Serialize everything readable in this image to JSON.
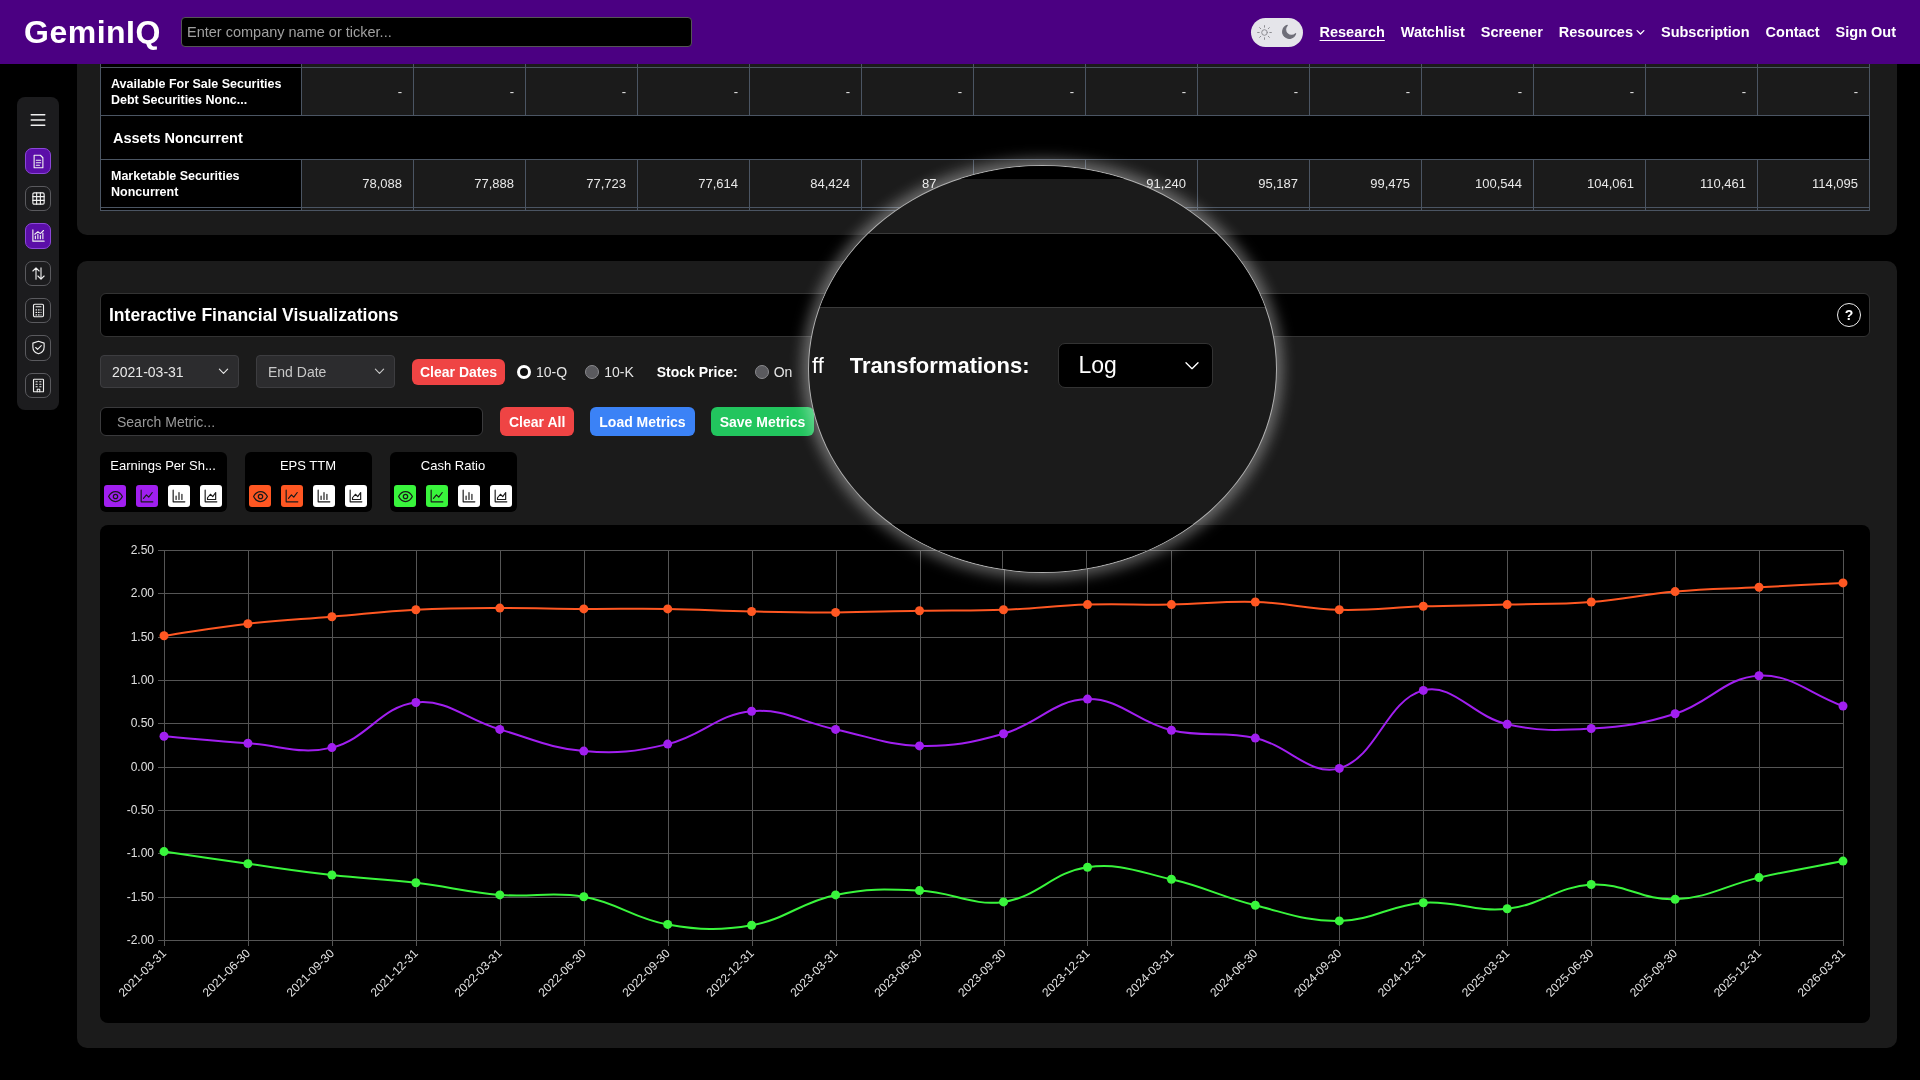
{
  "header": {
    "logo": "GeminIQ",
    "search": {
      "placeholder": "Enter company name or ticker..."
    },
    "theme_toggle": {
      "dark": true
    },
    "nav": [
      {
        "label": "Research",
        "selected": true,
        "dropdown": false
      },
      {
        "label": "Watchlist",
        "selected": false,
        "dropdown": false
      },
      {
        "label": "Screener",
        "selected": false,
        "dropdown": false
      },
      {
        "label": "Resources",
        "selected": false,
        "dropdown": true
      },
      {
        "label": "Subscription",
        "selected": false,
        "dropdown": false
      },
      {
        "label": "Contact",
        "selected": false,
        "dropdown": false
      },
      {
        "label": "Sign Out",
        "selected": false,
        "dropdown": false
      }
    ]
  },
  "sidebar": {
    "items": [
      {
        "kind": "menu",
        "selected": false
      },
      {
        "kind": "document",
        "selected": true
      },
      {
        "kind": "table",
        "selected": false
      },
      {
        "kind": "chart",
        "selected": true
      },
      {
        "kind": "transfer",
        "selected": false
      },
      {
        "kind": "calculator",
        "selected": false
      },
      {
        "kind": "shield",
        "selected": false
      },
      {
        "kind": "building",
        "selected": false
      }
    ]
  },
  "table": {
    "rows": [
      {
        "kind": "data",
        "label": "Available For Sale Securities Debt Securities Nonc...",
        "cells": [
          "-",
          "-",
          "-",
          "-",
          "-",
          "-",
          "-",
          "-",
          "-",
          "-",
          "-",
          "-",
          "-",
          "-"
        ]
      },
      {
        "kind": "section",
        "label": "Assets Noncurrent"
      },
      {
        "kind": "data",
        "label": "Marketable Securities Noncurrent",
        "cells": [
          "78,088",
          "77,888",
          "77,723",
          "77,614",
          "84,424",
          {
            "value": "87,",
            "kind": "clipped"
          },
          null,
          "91,240",
          "95,187",
          "99,475",
          "100,544",
          "104,061",
          "110,461",
          "114,095"
        ]
      }
    ]
  },
  "visualizations": {
    "title": "Interactive Financial Visualizations",
    "help": "?",
    "start_date": {
      "value": "2021-03-31"
    },
    "end_date": {
      "placeholder": "End Date"
    },
    "clear_dates": {
      "label": "Clear Dates",
      "kind": "danger"
    },
    "filing_types": [
      {
        "label": "10-Q",
        "selected": true
      },
      {
        "label": "10-K",
        "selected": false
      }
    ],
    "stock_price": {
      "label": "Stock Price:",
      "options": [
        {
          "label": "On",
          "selected": false
        }
      ]
    },
    "search": {
      "placeholder": "Search Metric..."
    },
    "buttons": [
      {
        "label": "Clear All",
        "kind": "danger"
      },
      {
        "label": "Load Metrics",
        "kind": "primary"
      },
      {
        "label": "Save Metrics",
        "kind": "success"
      }
    ],
    "metrics": [
      {
        "name": "Earnings Per Sh...",
        "color": "#a11ff0",
        "visible": true,
        "chart_types": [
          {
            "kind": "line",
            "selected": true
          },
          {
            "kind": "bar",
            "selected": false
          },
          {
            "kind": "area",
            "selected": false
          }
        ]
      },
      {
        "name": "EPS TTM",
        "color": "#ff5722",
        "visible": true,
        "chart_types": [
          {
            "kind": "line",
            "selected": true
          },
          {
            "kind": "bar",
            "selected": false
          },
          {
            "kind": "area",
            "selected": false
          }
        ]
      },
      {
        "name": "Cash Ratio",
        "color": "#39f53c",
        "visible": true,
        "chart_types": [
          {
            "kind": "line",
            "selected": true
          },
          {
            "kind": "bar",
            "selected": false
          },
          {
            "kind": "area",
            "selected": false
          }
        ]
      }
    ],
    "chart": {
      "chart_data": {
        "type": "line",
        "grid": true,
        "categories": [
          "2021-03-31",
          "2021-06-30",
          "2021-09-30",
          "2021-12-31",
          "2022-03-31",
          "2022-06-30",
          "2022-09-30",
          "2022-12-31",
          "2023-03-31",
          "2023-06-30",
          "2023-09-30",
          "2023-12-31",
          "2024-03-31",
          "2024-06-30",
          "2024-09-30",
          "2024-12-31",
          "2025-03-31",
          "2025-06-30",
          "2025-09-30",
          "2025-12-31",
          "2026-03-31"
        ],
        "ylim": [
          -2,
          2.5
        ],
        "yticks": [
          {
            "value": -2,
            "label": "-2.00"
          },
          {
            "value": -1.5,
            "label": "-1.50"
          },
          {
            "value": -1,
            "label": "-1.00"
          },
          {
            "value": -0.5,
            "label": "-0.50"
          },
          {
            "value": 0,
            "label": "0.00"
          },
          {
            "value": 0.5,
            "label": "0.50"
          },
          {
            "value": 1,
            "label": "1.00"
          },
          {
            "value": 1.5,
            "label": "1.50"
          },
          {
            "value": 2,
            "label": "2.00"
          },
          {
            "value": 2.5,
            "label": "2.50"
          }
        ],
        "series": [
          {
            "color": "#a11ff0",
            "marker": "circle",
            "values": [
              0.35,
              0.27,
              0.22,
              0.74,
              0.43,
              0.18,
              0.26,
              0.64,
              0.43,
              0.24,
              0.38,
              0.78,
              0.42,
              0.33,
              -0.02,
              0.88,
              0.49,
              0.44,
              0.61,
              1.05,
              0.7
            ]
          },
          {
            "color": "#ff5722",
            "marker": "circle",
            "values": [
              1.51,
              1.65,
              1.73,
              1.81,
              1.83,
              1.82,
              1.82,
              1.79,
              1.78,
              1.8,
              1.81,
              1.87,
              1.87,
              1.9,
              1.81,
              1.85,
              1.87,
              1.9,
              2.02,
              2.07,
              2.12
            ]
          },
          {
            "color": "#39f53c",
            "marker": "circle",
            "values": [
              -0.98,
              -1.12,
              -1.25,
              -1.34,
              -1.48,
              -1.5,
              -1.82,
              -1.83,
              -1.48,
              -1.43,
              -1.56,
              -1.16,
              -1.3,
              -1.6,
              -1.78,
              -1.57,
              -1.64,
              -1.36,
              -1.53,
              -1.28,
              -1.09
            ]
          }
        ]
      }
    }
  },
  "magnifier": {
    "fragment": "ff",
    "label": "Transformations:",
    "select": {
      "value": "Log"
    }
  }
}
